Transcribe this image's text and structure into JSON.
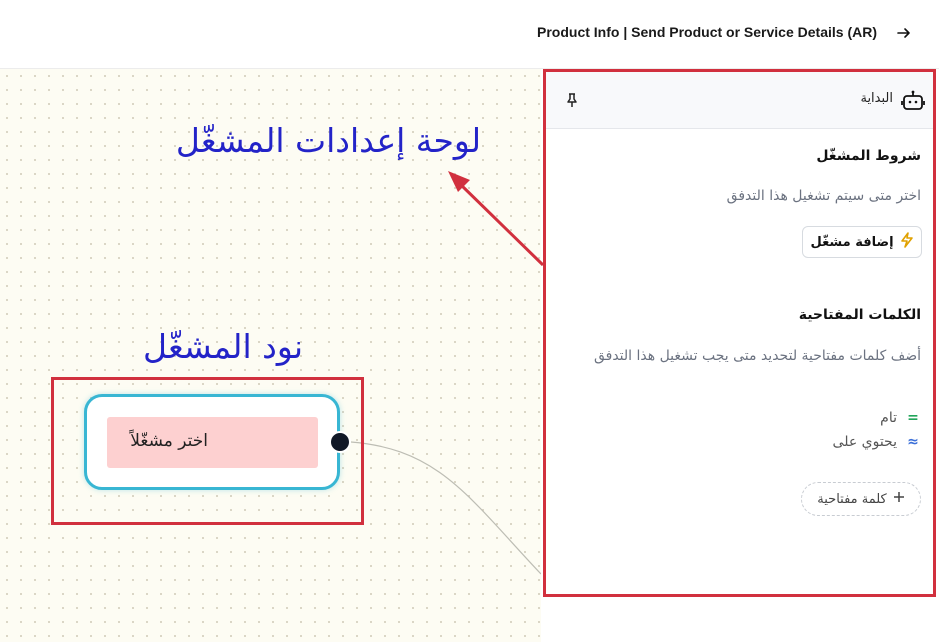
{
  "header": {
    "title": "Product Info | Send Product or Service Details (AR)",
    "back_icon": "arrow-right-icon"
  },
  "canvas": {
    "annotation_panel": "لوحة إعدادات المشغّل",
    "annotation_node": "نود المشغّل",
    "trigger_node": {
      "label": "اختر مشغّلاً"
    }
  },
  "panel": {
    "header": {
      "label": "البداية",
      "icon": "robot-icon",
      "pin_icon": "pin-icon"
    },
    "trigger_section": {
      "title": "شروط المشغّل",
      "description": "اختر متى سيتم تشغيل هذا التدفق",
      "add_button": "إضافة مشغّل",
      "add_icon": "lightning-icon"
    },
    "keywords_section": {
      "title": "الكلمات المفتاحية",
      "description": "أضف كلمات مفتاحية لتحديد متى يجب تشغيل هذا التدفق",
      "options": [
        {
          "symbol": "=",
          "label": "تام",
          "color": "#22a55a"
        },
        {
          "symbol": "≈",
          "label": "يحتوي على",
          "color": "#3b6fd8"
        }
      ],
      "add_button": "كلمة مفتاحية",
      "add_icon": "plus-icon"
    }
  },
  "colors": {
    "annotation_text": "#2323c8",
    "highlight_border": "#d1303e",
    "node_border": "#38b6d3",
    "node_pill": "#fdd0d0"
  }
}
